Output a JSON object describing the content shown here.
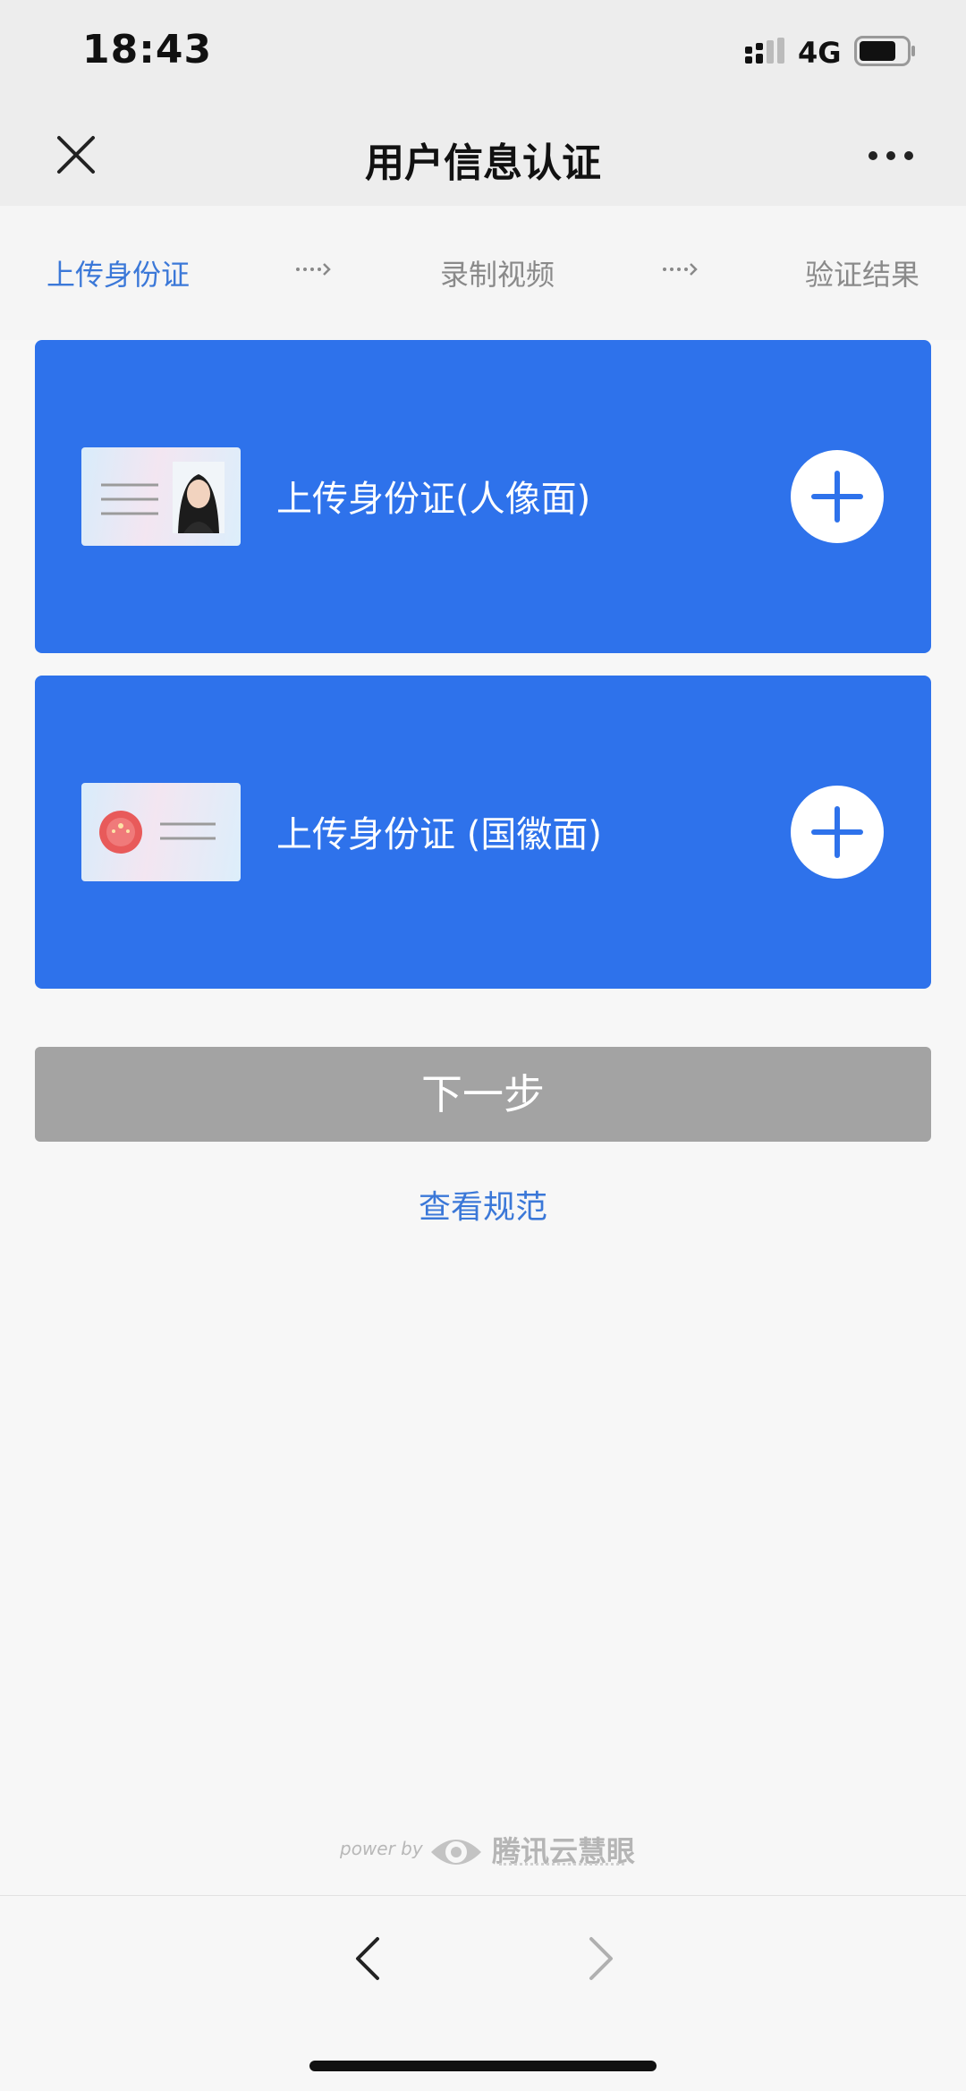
{
  "status_bar": {
    "time": "18:43",
    "network": "4G",
    "signal_icon": "signal-icon",
    "battery_icon": "battery-icon"
  },
  "nav": {
    "title": "用户信息认证",
    "close_icon": "close-icon",
    "more_icon": "more-icon"
  },
  "steps": [
    {
      "label": "上传身份证",
      "active": true
    },
    {
      "label": "录制视频",
      "active": false
    },
    {
      "label": "验证结果",
      "active": false
    }
  ],
  "cards": {
    "front": {
      "label": "上传身份证(人像面)"
    },
    "back": {
      "label": "上传身份证 (国徽面)"
    }
  },
  "actions": {
    "next_label": "下一步",
    "spec_link": "查看规范"
  },
  "footer": {
    "powered_by": "power by",
    "brand_name": "腾讯云慧眼"
  },
  "colors": {
    "accent": "#2e72eb",
    "link": "#3b78d8",
    "disabled_button": "#a3a3a3",
    "background": "#f7f7f7"
  }
}
